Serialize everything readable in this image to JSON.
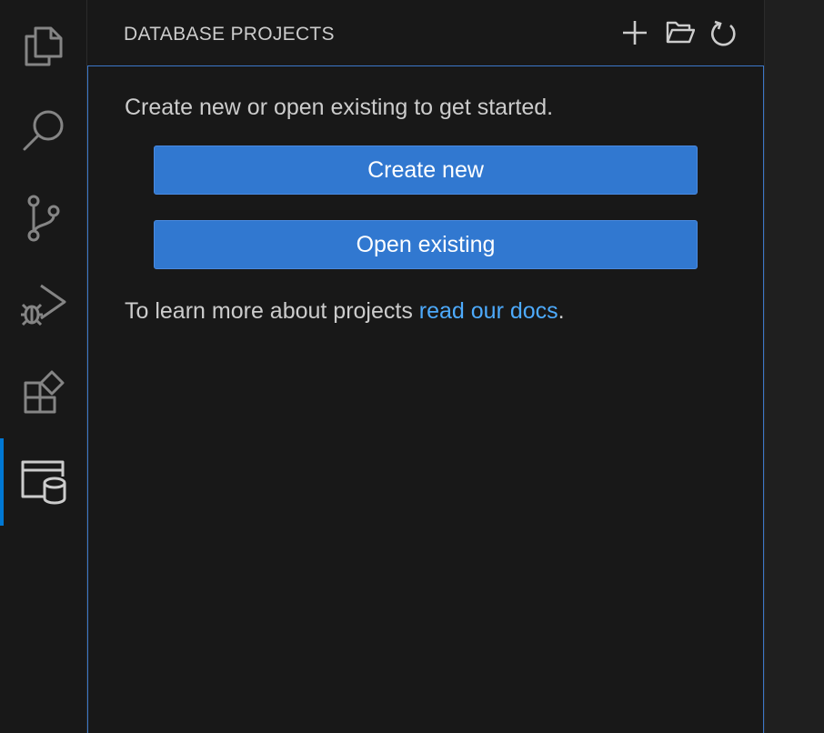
{
  "colors": {
    "accent": "#0078d4",
    "button_bg": "#3178d0",
    "link": "#4daafc",
    "focus_border": "#3b77c9"
  },
  "activity_bar": {
    "items": [
      {
        "name": "explorer",
        "icon": "files-icon",
        "active": false
      },
      {
        "name": "search",
        "icon": "search-icon",
        "active": false
      },
      {
        "name": "source-control",
        "icon": "source-control-icon",
        "active": false
      },
      {
        "name": "run-and-debug",
        "icon": "run-debug-icon",
        "active": false
      },
      {
        "name": "extensions",
        "icon": "extensions-icon",
        "active": false
      },
      {
        "name": "database-projects",
        "icon": "database-project-icon",
        "active": true
      }
    ]
  },
  "sidebar": {
    "title": "DATABASE PROJECTS",
    "actions": [
      {
        "name": "new-project",
        "icon": "plus-icon"
      },
      {
        "name": "open-project",
        "icon": "folder-open-icon"
      },
      {
        "name": "refresh",
        "icon": "refresh-icon"
      }
    ],
    "welcome_text": "Create new or open existing to get started.",
    "create_button_label": "Create new",
    "open_button_label": "Open existing",
    "learn_text_prefix": "To learn more about projects ",
    "docs_link_text": "read our docs",
    "learn_text_suffix": "."
  }
}
